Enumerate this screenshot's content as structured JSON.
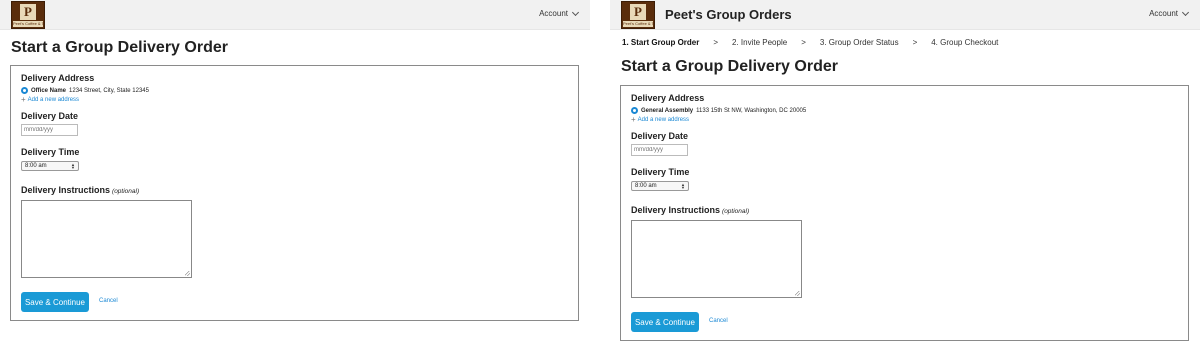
{
  "left": {
    "logo_text": "Peet's Coffee & Tea",
    "account_label": "Account",
    "page_title": "Start a Group Delivery Order",
    "form": {
      "address_label": "Delivery Address",
      "address_name": "Office Name",
      "address_detail": "1234 Street, City, State 12345",
      "add_address": "Add a new address",
      "date_label": "Delivery Date",
      "date_placeholder": "mm/dd/yyy",
      "time_label": "Delivery Time",
      "time_value": "8:00 am",
      "instructions_label": "Delivery Instructions",
      "instructions_optional": "(optional)",
      "save_label": "Save & Continue",
      "cancel_label": "Cancel"
    }
  },
  "right": {
    "logo_text": "Peet's Coffee & Tea",
    "app_title": "Peet's Group Orders",
    "account_label": "Account",
    "steps": [
      {
        "label": "1. Start Group Order",
        "active": true
      },
      {
        "label": "2. Invite People",
        "active": false
      },
      {
        "label": "3. Group Order Status",
        "active": false
      },
      {
        "label": "4. Group Checkout",
        "active": false
      }
    ],
    "step_separator": ">",
    "page_title": "Start a Group Delivery Order",
    "form": {
      "address_label": "Delivery Address",
      "address_name": "General Assembly",
      "address_detail": "1133 15th St NW, Washington, DC 20005",
      "add_address": "Add a new address",
      "date_label": "Delivery Date",
      "date_placeholder": "mm/dd/yyy",
      "time_label": "Delivery Time",
      "time_value": "8:00 am",
      "instructions_label": "Delivery Instructions",
      "instructions_optional": "(optional)",
      "save_label": "Save & Continue",
      "cancel_label": "Cancel"
    }
  },
  "colors": {
    "accent": "#1a9ad6",
    "link": "#1a88d4",
    "topbar": "#f1f1f1",
    "logo_brown": "#5a2d0c"
  },
  "icons": [
    "peets-logo-icon",
    "chevron-down-icon",
    "radio-selected-icon",
    "plus-icon",
    "select-arrows-icon",
    "resize-handle-icon"
  ]
}
